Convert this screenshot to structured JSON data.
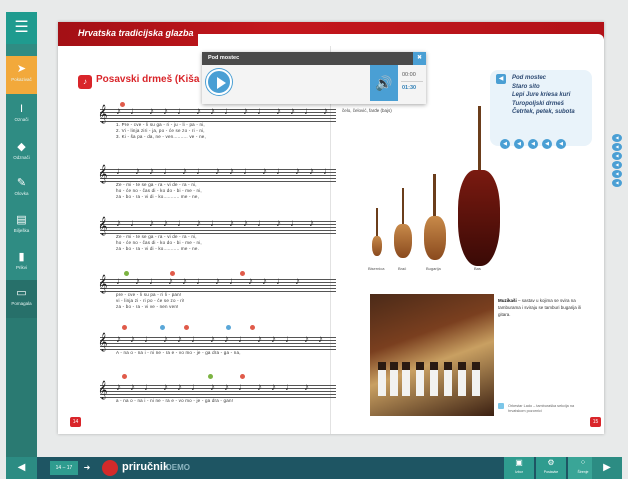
{
  "sidebar": {
    "menu_icon": "hamburger-icon",
    "tools": [
      {
        "label": "Pokazivač",
        "icon": "pointer-icon"
      },
      {
        "label": "Označi",
        "icon": "text-cursor-icon"
      },
      {
        "label": "Odznači",
        "icon": "eraser-icon"
      },
      {
        "label": "Olovka",
        "icon": "pen-icon"
      },
      {
        "label": "Bilješka",
        "icon": "note-icon"
      },
      {
        "label": "Prikvi",
        "icon": "pin-icon"
      },
      {
        "label": "Pomagala",
        "icon": "toolbox-icon"
      }
    ]
  },
  "bottom_bar": {
    "page_range": "14 – 17",
    "brand_name": "priručnik",
    "brand_tag": "DEMO",
    "buttons": [
      {
        "label": "Izbor",
        "icon": "selection-icon"
      },
      {
        "label": "Postavke",
        "icon": "settings-icon"
      },
      {
        "label": "Širenje",
        "icon": "grid-icon"
      }
    ]
  },
  "book": {
    "chapter_title": "Hrvatska tradicijska glazba",
    "song_title": "Posavski drmeš (Kiša pa",
    "lyrics": [
      "1. Pre - cve - li   su   ga - ri - ju - li - pa - ni,",
      "2. Vi - linja   ziri - ja,   po - će   se   zo - ri - ni,",
      "3. Ki - ša   pa - da,   ne - ven.......... ve - ne,",
      "Ze - mi - te   se   ga - ra - vi   de - ra - ni,",
      "ho - će   no - čas   di - ko   do - bi - me - ni,",
      "za - bo - ra - vi   di - ko........... me - ne,",
      "Ze - mi - te   se   ga - ra - vi   de - ra - ni,",
      "ho - će   no - čas   di - ko   do - bi - me - ni,",
      "za - bo - ra - vi   di - ko........... me - ne.",
      "pre - cve - li   su   pa - ri   li - pan!",
      "vi - linja   zi - ri   po - će   se   zo - ri!",
      "za - bo - ra - vi   ve - nen   ven!",
      "A - na   o - na   i - ni   ne - ra   e - vo   mo - je - ga   dra - ga - na,",
      "a - na   o - na   i - ni   ne - ra   e - vo   mo - je - ga   dra - gan!"
    ],
    "page_left": "14",
    "page_right": "15",
    "instruments_caption": "čelo, čelović, farđe (bajs)",
    "instrument_labels": [
      "Bisernica",
      "Brač",
      "Bugarija",
      "Bas"
    ],
    "musikasi_title": "Muzikaši",
    "musikasi_text": " – sastav u kojima se svira na tamburama i sviraju se tamburi bugarija ili gitara.",
    "photo_caption": "Orkestar Lado – tamburaška sekcija na hrvatskom pozornici"
  },
  "songlist": {
    "items": [
      "Pod mostec",
      "Staro sito",
      "Lepi Jure kriesa kuri",
      "Turopoljski drmeš",
      "Četrtek, petek, subota"
    ]
  },
  "player": {
    "title": "Pod mostec",
    "time_now": "00:00",
    "time_total": "01:30"
  },
  "colors": {
    "accent_teal": "#2f8c83",
    "accent_orange": "#f2a93b",
    "brand_red": "#c4161c",
    "player_blue": "#4a9fd4"
  }
}
